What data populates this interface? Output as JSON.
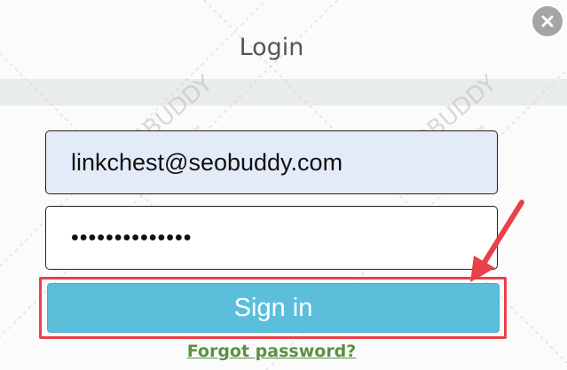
{
  "modal": {
    "title": "Login",
    "email_value": "linkchest@seobuddy.com",
    "password_value": "••••••••••••••",
    "signin_label": "Sign in",
    "forgot_label": "Forgot password?",
    "close_icon": "close-icon"
  },
  "watermark": {
    "brand": "SEOBUDDY",
    "site": "WWW.SEOBUDDY.COM"
  },
  "colors": {
    "accent": "#5bbfdc",
    "highlight": "#e8414a",
    "link": "#5a9142",
    "email_bg": "#e4ebf8"
  }
}
